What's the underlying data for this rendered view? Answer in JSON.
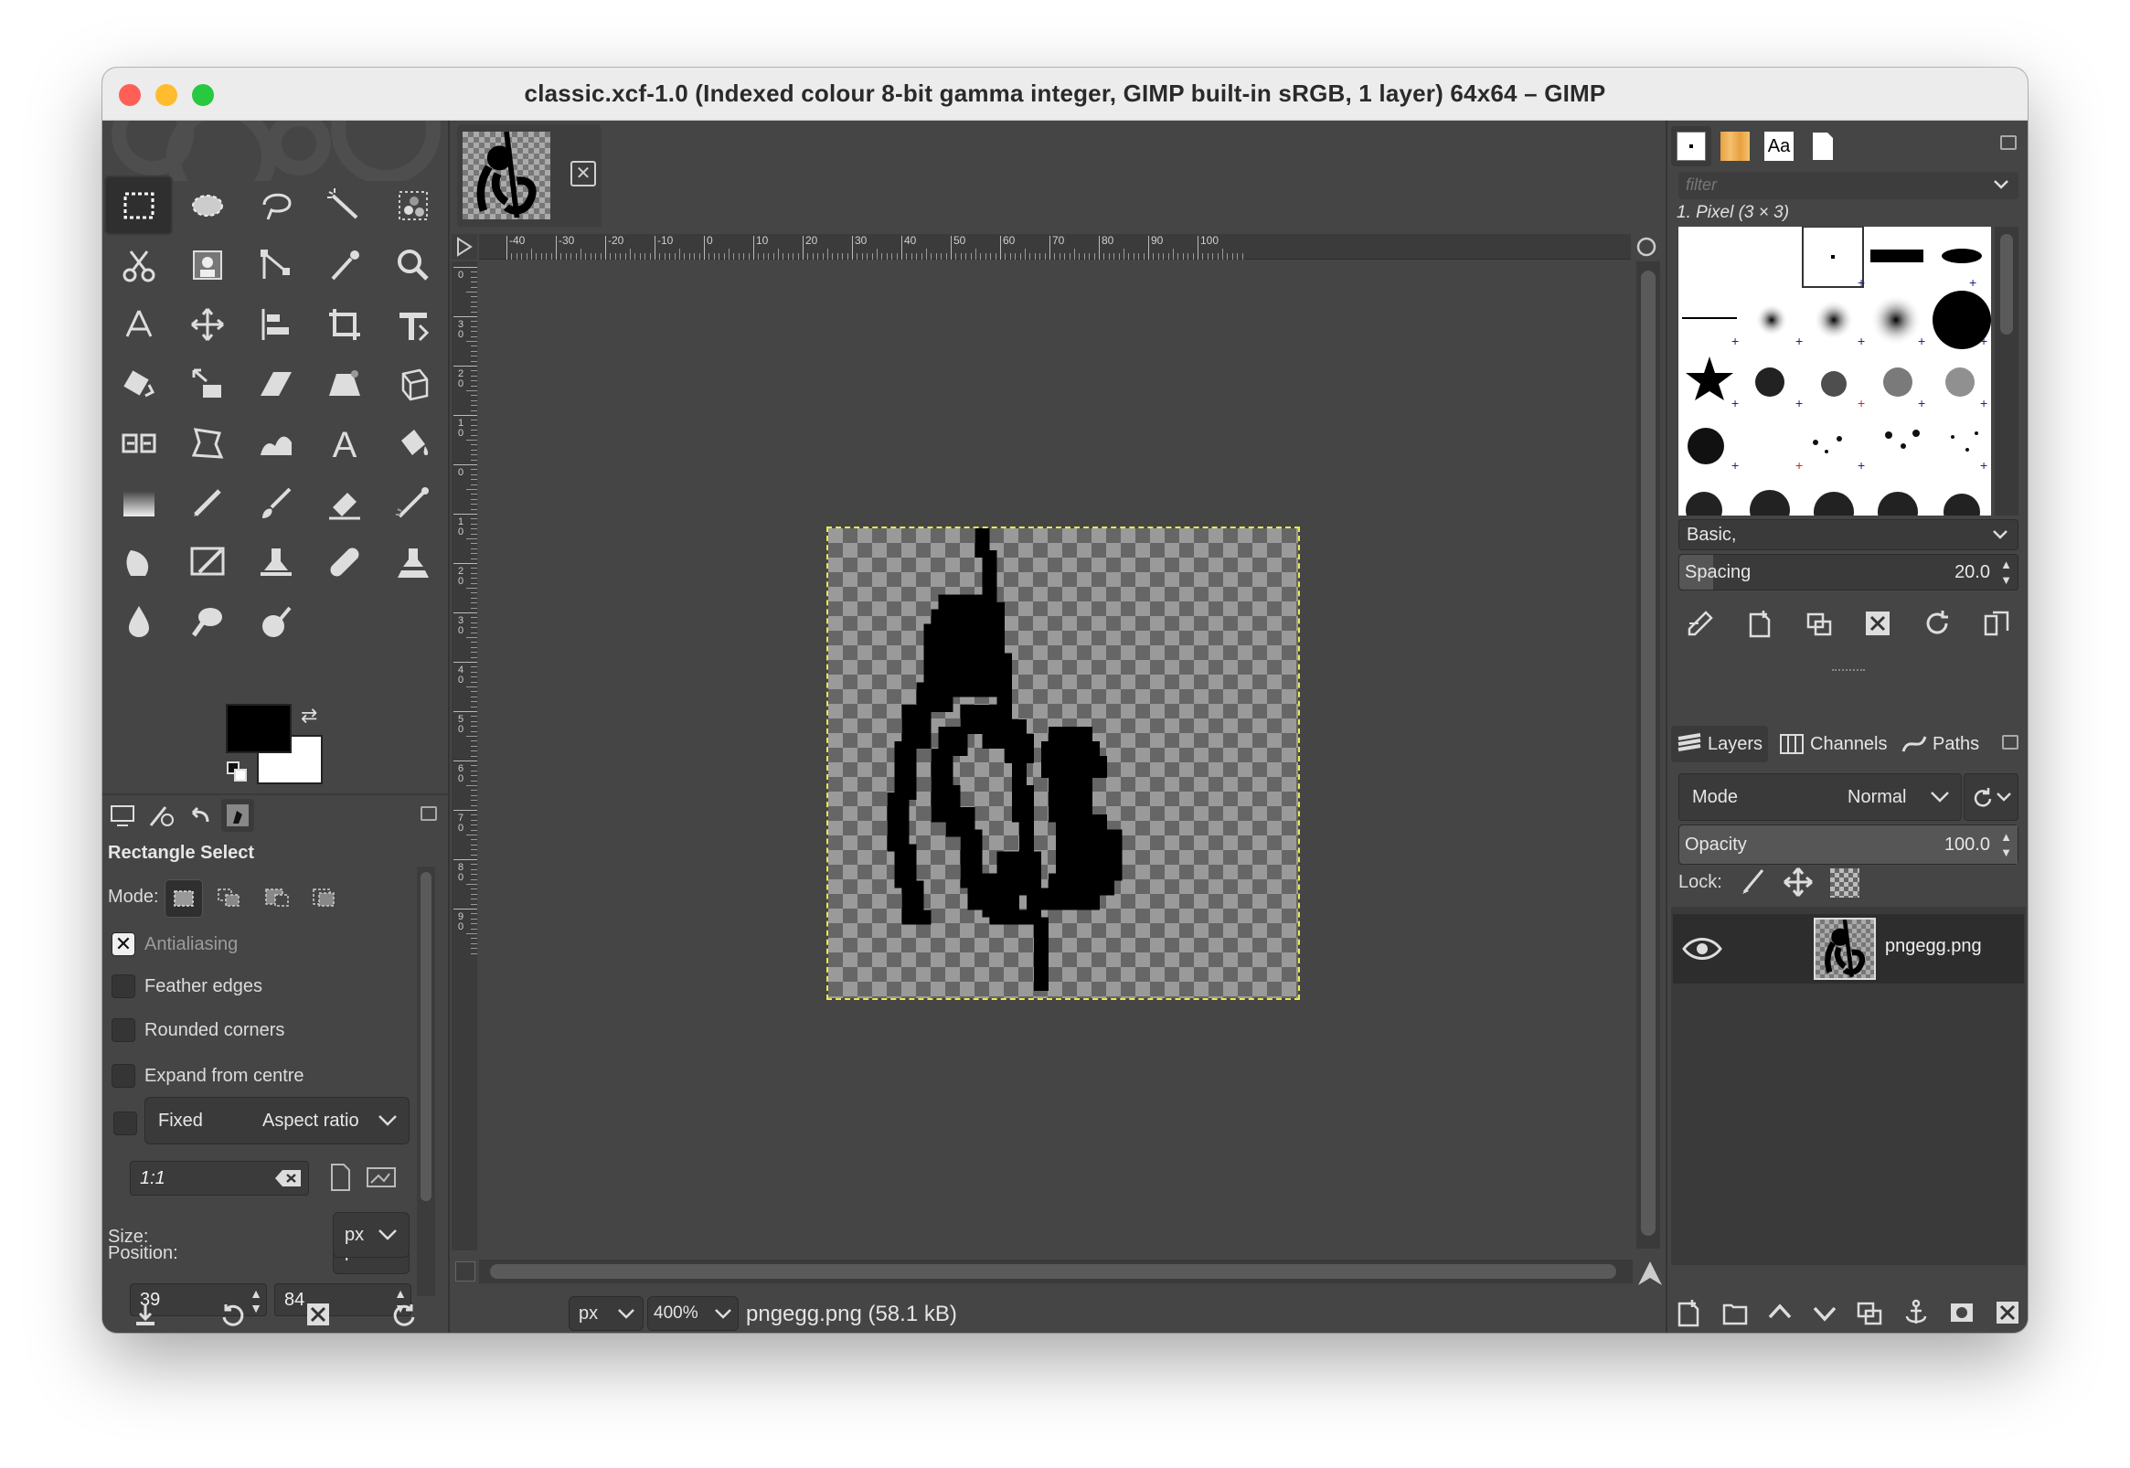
{
  "window": {
    "title": "classic.xcf-1.0 (Indexed colour 8-bit gamma integer, GIMP built-in sRGB, 1 layer) 64x64 – GIMP",
    "traffic_colors": [
      "#ff5f57",
      "#febc2e",
      "#28c840"
    ]
  },
  "toolbox": {
    "active_tool": "rectangle-select",
    "tools": [
      "rect-select-icon",
      "ellipse-select-icon",
      "free-select-icon",
      "fuzzy-select-icon",
      "color-select-icon",
      "scissors-icon",
      "foreground-select-icon",
      "paths-icon",
      "color-picker-icon",
      "zoom-icon",
      "measure-icon",
      "move-icon",
      "align-icon",
      "crop-icon",
      "unified-transform-icon",
      "rotate-icon",
      "scale-icon",
      "shear-icon",
      "perspective-icon",
      "3d-transform-icon",
      "flip-icon",
      "cage-transform-icon",
      "warp-transform-icon",
      "text-icon",
      "bucket-fill-icon",
      "gradient-icon",
      "pencil-icon",
      "paintbrush-icon",
      "eraser-icon",
      "airbrush-icon",
      "ink-icon",
      "mypaint-brush-icon",
      "clone-icon",
      "heal-icon",
      "perspective-clone-icon",
      "blur-icon",
      "smudge-icon",
      "dodge-burn-icon"
    ],
    "fg_color": "#000000",
    "bg_color": "#ffffff"
  },
  "tool_options": {
    "title": "Rectangle Select",
    "mode_label": "Mode:",
    "antialiasing": "Antialiasing",
    "feather_edges": "Feather edges",
    "rounded_corners": "Rounded corners",
    "expand_from_centre": "Expand from centre",
    "fixed_label": "Fixed",
    "fixed_value": "Aspect ratio",
    "ratio_value": "1:1",
    "position_label": "Position:",
    "position_unit": "px",
    "position_x": "39",
    "position_y": "84",
    "size_label": "Size:",
    "size_unit": "px"
  },
  "canvas": {
    "ruler_labels": [
      "-40",
      "-30",
      "-20",
      "-10",
      "0",
      "10",
      "20",
      "30",
      "40",
      "50",
      "60",
      "70",
      "80",
      "90",
      "100"
    ],
    "vruler_labels": [
      "0",
      "3 0",
      "2 0",
      "1 0",
      "0",
      "1 0",
      "2 0",
      "3 0",
      "4 0",
      "5 0",
      "6 0",
      "7 0",
      "8 0",
      "9 0"
    ],
    "unit": "px",
    "zoom": "400%",
    "status": "pngegg.png (58.1 kB)"
  },
  "brushes": {
    "filter_placeholder": "filter",
    "selected_brush": "1. Pixel (3 × 3)",
    "tag_value": "Basic,",
    "spacing_label": "Spacing",
    "spacing_value": "20.0",
    "spacing_fraction": 0.1
  },
  "layers": {
    "tabs": [
      "Layers",
      "Channels",
      "Paths"
    ],
    "mode_label": "Mode",
    "mode_value": "Normal",
    "opacity_label": "Opacity",
    "opacity_value": "100.0",
    "lock_label": "Lock:",
    "layer_name": "pngegg.png"
  }
}
